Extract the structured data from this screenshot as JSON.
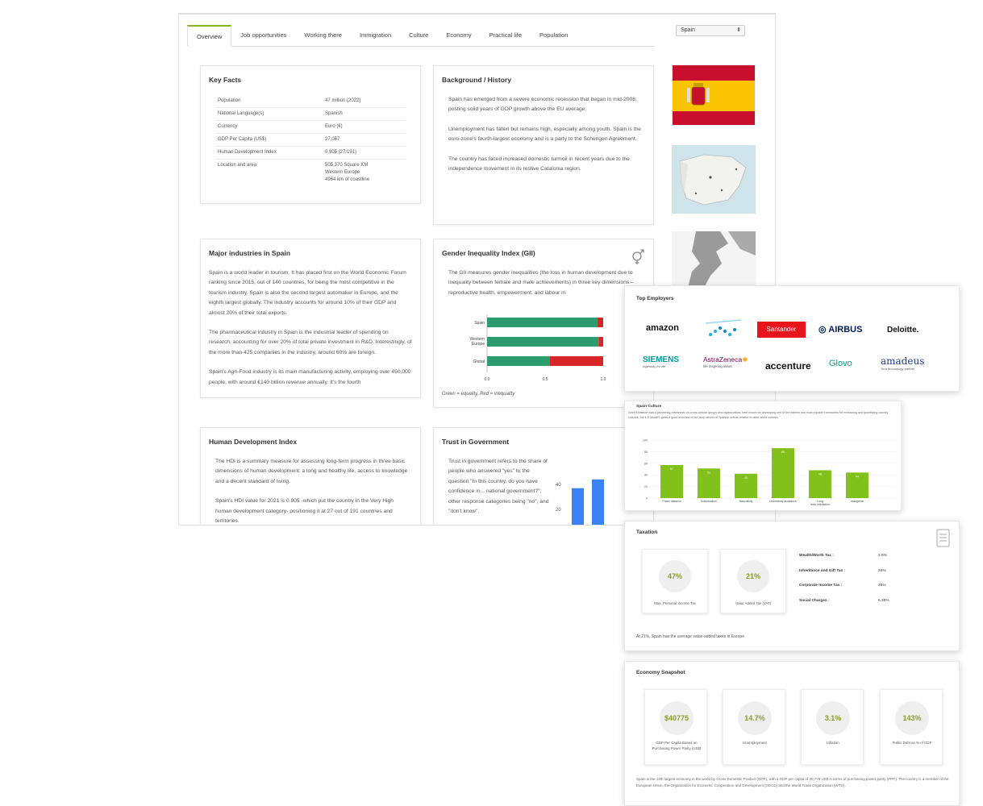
{
  "tabs": [
    "Overview",
    "Job opportunities",
    "Working there",
    "Immigration",
    "Culture",
    "Economy",
    "Practical life",
    "Population"
  ],
  "country_select": {
    "value": "Spain"
  },
  "key_facts": {
    "title": "Key Facts",
    "rows": [
      {
        "label": "Population",
        "value": "47 million (2022)"
      },
      {
        "label": "National Language(s)",
        "value": "Spanish"
      },
      {
        "label": "Currency",
        "value": "Euro (€)"
      },
      {
        "label": "GDP Per Capita (US$)",
        "value": "27,057"
      },
      {
        "label": "Human Development Index",
        "value": "0.905 (27/191)"
      },
      {
        "label": "Location and area",
        "value": "505,370 Square KM"
      }
    ],
    "location_extra1": "Western Europe",
    "location_extra2": "4964 km of coastline"
  },
  "background": {
    "title": "Background / History",
    "p1": "Spain has emerged from a severe economic recession that began in mid-2008, posting solid years of GDP growth above the EU average.",
    "p2": "Unemployment has fallen but remains high, especially among youth. Spain is the euro-zone's fourth-largest economy and is a party to the Schengen Agreement.",
    "p3": "The country has faced increased domestic turmoil in recent years due to the independence movement in its restive Catalonia region."
  },
  "industries": {
    "title": "Major industries in Spain",
    "p1": "Spain is a world leader in tourism. It has placed first on the World Economic Forum ranking since 2015, out of 140 countries, for being the most competitive in the tourism industry. Spain is also the second largest automaker in Europe, and the eighth largest globally. The industry accounts for around 10% of their GDP and almost 20% of their total exports.",
    "p2": "The pharmaceutical industry in Spain is the industrial leader of spending on research, accounting for over 20% of total private investment in R&D. Interestingly, of the more than 425 companies in the industry, around 60% are foreign.",
    "p3": "Spain's Agri-Food industry is its main manufacturing activity, employing over 450,000 people, with around €140 billion revenue annually. It's the fourth"
  },
  "gender": {
    "title": "Gender Inequality Index (GII)",
    "text": "The GII measures gender inequalities (the loss in human development due to inequality between female and male achievements) in three key dimensions – reproductive health, empowerment, and labour m",
    "caption": "Green = equality, Red = inequality",
    "colors": {
      "equality": "#2e9b6e",
      "inequality": "#d62728"
    }
  },
  "hdi": {
    "title": "Human Development Index",
    "p1": "The HDI is a summary measure for assessing long-term progress in three basic dimensions of human development: a long and healthy life, access to knowledge and a decent standard of living.",
    "p2": "Spain's HDI value for 2021 is 0.905 -which put the country in the Very High human development category- positioning it at 27 out of 191 countries and territories."
  },
  "trust": {
    "title": "Trust in Government",
    "text": "Trust in government refers to the share of people who answered \"yes\" to the question \"In this country, do you have confidence in... national government?\", other response categories being \"no\", and \"don't know\".",
    "bar_values": [
      37,
      44
    ]
  },
  "employers": {
    "title": "Top Employers",
    "logos": [
      "amazon",
      "Santander",
      "AIRBUS",
      "Deloitte.",
      "SIEMENS",
      "AstraZeneca",
      "accenture",
      "Glovo",
      "amadeus"
    ],
    "siemens_tag": "Ingenuity for life",
    "astra_tag": "life inspiring ideas",
    "amadeus_tag": "Your technology partner"
  },
  "culture": {
    "title": "Spain Culture",
    "text": "Geert Hofstede was a pioneering researcher on cross-cultural groups and organizations, best known for developing one of the earliest and most popular frameworks for measuring and quantifying country cultures; the 6-D Model© gives a good overview of the deep drivers of Spanish culture relative to other world cultures.",
    "color": "#82c01b"
  },
  "taxation": {
    "title": "Taxation",
    "c1_value": "47%",
    "c1_label": "Max. Personal Income Tax",
    "c2_value": "21%",
    "c2_label": "Value Added Tax (VAT)",
    "rows": [
      {
        "label": "Wealth/Worth Tax :",
        "value": "3.5%"
      },
      {
        "label": "Inheritance and Gift Tax :",
        "value": "34%"
      },
      {
        "label": "Corporate Income Tax :",
        "value": "25%"
      },
      {
        "label": "Social Charges :",
        "value": "6.35%"
      }
    ],
    "note": "At 21%, Spain has the average value-added taxes in Europe"
  },
  "economy": {
    "title": "Economy Snapshot",
    "items": [
      {
        "value": "$40775",
        "label": "GDP Per Capita Based on Purchasing Power Parity (US$)"
      },
      {
        "value": "14.7%",
        "label": "Unemployment"
      },
      {
        "value": "3.1%",
        "label": "Inflation"
      },
      {
        "value": "143%",
        "label": "Public Debt as % of GDP"
      }
    ],
    "note": "Spain is the 14th largest economy in the world by Gross Domestic Product (GDP), with a GDP per capita of 40,775 US$ in terms of purchasing power parity (PPP). The country is a member of the European Union, the Organization for Economic Cooperation and Development (OECD) and the World Trade Organization (WTO)."
  },
  "chart_data": [
    {
      "type": "bar",
      "title": "Gender Inequality Index (GII)",
      "orientation": "horizontal-stacked",
      "categories": [
        "Spain",
        "Western Europe",
        "Global"
      ],
      "series": [
        {
          "name": "Green = equality",
          "values": [
            0.95,
            0.96,
            0.54
          ]
        },
        {
          "name": "Red = inequality",
          "values": [
            0.05,
            0.04,
            0.46
          ]
        }
      ],
      "xticks": [
        "0.0",
        "0.5",
        "1.0"
      ],
      "xlim": [
        0,
        1
      ]
    },
    {
      "type": "bar",
      "title": "Trust in Government",
      "values": [
        37,
        44
      ],
      "yticks": [
        "20",
        "40"
      ]
    },
    {
      "type": "bar",
      "title": "Spain Culture",
      "categories": [
        "Power distance",
        "Individualism",
        "Masculinity",
        "Uncertainty avoidance",
        "Long term orientation",
        "Indulgence"
      ],
      "values": [
        57,
        51,
        42,
        86,
        48,
        44
      ],
      "data_labels": [
        "57",
        "51",
        "42",
        "86",
        "48",
        "44"
      ],
      "yticks": [
        "0",
        "20",
        "40",
        "60",
        "80",
        "100"
      ],
      "ylim": [
        0,
        100
      ]
    }
  ]
}
